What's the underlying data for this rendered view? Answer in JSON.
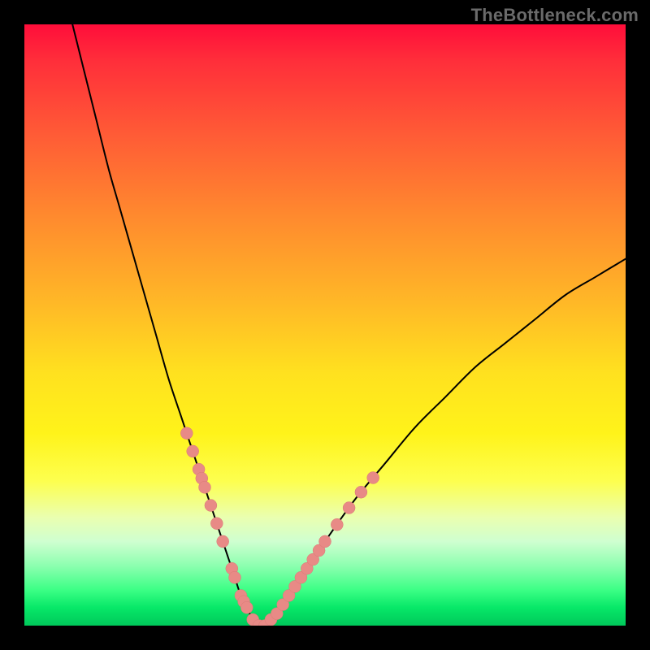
{
  "watermark": "TheBottleneck.com",
  "colors": {
    "curve_stroke": "#000000",
    "marker_fill": "#e88a86",
    "marker_stroke": "#d97a76"
  },
  "chart_data": {
    "type": "line",
    "title": "",
    "xlabel": "",
    "ylabel": "",
    "xlim": [
      0,
      100
    ],
    "ylim": [
      0,
      100
    ],
    "x": [
      8,
      10,
      12,
      14,
      16,
      18,
      20,
      22,
      24,
      26,
      27,
      28,
      29,
      30,
      31,
      32,
      33,
      34,
      35,
      36,
      37,
      38,
      39,
      40,
      42,
      44,
      46,
      48,
      50,
      55,
      60,
      65,
      70,
      75,
      80,
      85,
      90,
      95,
      100
    ],
    "values": [
      100,
      92,
      84,
      76,
      69,
      62,
      55,
      48,
      41,
      35,
      32,
      29,
      26,
      23,
      20,
      17,
      14,
      11,
      8,
      5,
      3,
      1,
      0,
      0,
      2,
      5,
      8,
      11,
      14,
      21,
      27,
      33,
      38,
      43,
      47,
      51,
      55,
      58,
      61
    ],
    "series_name": "bottleneck",
    "markers": [
      {
        "x": 27,
        "y": 32
      },
      {
        "x": 28,
        "y": 29
      },
      {
        "x": 29,
        "y": 26
      },
      {
        "x": 29.5,
        "y": 24.5
      },
      {
        "x": 30,
        "y": 23
      },
      {
        "x": 31,
        "y": 20
      },
      {
        "x": 32,
        "y": 17
      },
      {
        "x": 33,
        "y": 14
      },
      {
        "x": 34.5,
        "y": 9.5
      },
      {
        "x": 35,
        "y": 8
      },
      {
        "x": 36,
        "y": 5
      },
      {
        "x": 36.5,
        "y": 4
      },
      {
        "x": 37,
        "y": 3
      },
      {
        "x": 38,
        "y": 1
      },
      {
        "x": 39,
        "y": 0
      },
      {
        "x": 40,
        "y": 0
      },
      {
        "x": 41,
        "y": 1
      },
      {
        "x": 42,
        "y": 2
      },
      {
        "x": 43,
        "y": 3.5
      },
      {
        "x": 44,
        "y": 5
      },
      {
        "x": 45,
        "y": 6.5
      },
      {
        "x": 46,
        "y": 8
      },
      {
        "x": 47,
        "y": 9.5
      },
      {
        "x": 48,
        "y": 11
      },
      {
        "x": 49,
        "y": 12.5
      },
      {
        "x": 50,
        "y": 14
      },
      {
        "x": 52,
        "y": 16.8
      },
      {
        "x": 54,
        "y": 19.6
      },
      {
        "x": 56,
        "y": 22.2
      },
      {
        "x": 58,
        "y": 24.6
      }
    ]
  }
}
